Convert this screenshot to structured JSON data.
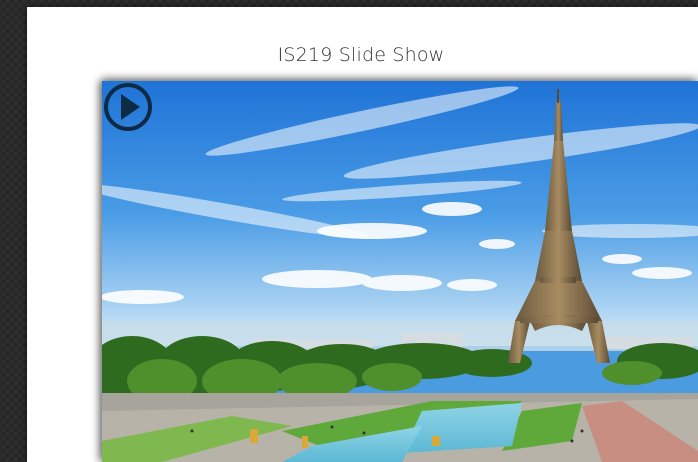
{
  "page": {
    "title": "IS219 Slide Show"
  },
  "slideshow": {
    "play_icon": "play-circle-icon",
    "current_slide": {
      "subject": "eiffel-tower-paris"
    }
  },
  "colors": {
    "page_background": "#2b2b2b",
    "panel_background": "#ffffff",
    "play_button": "#0d2b44"
  }
}
